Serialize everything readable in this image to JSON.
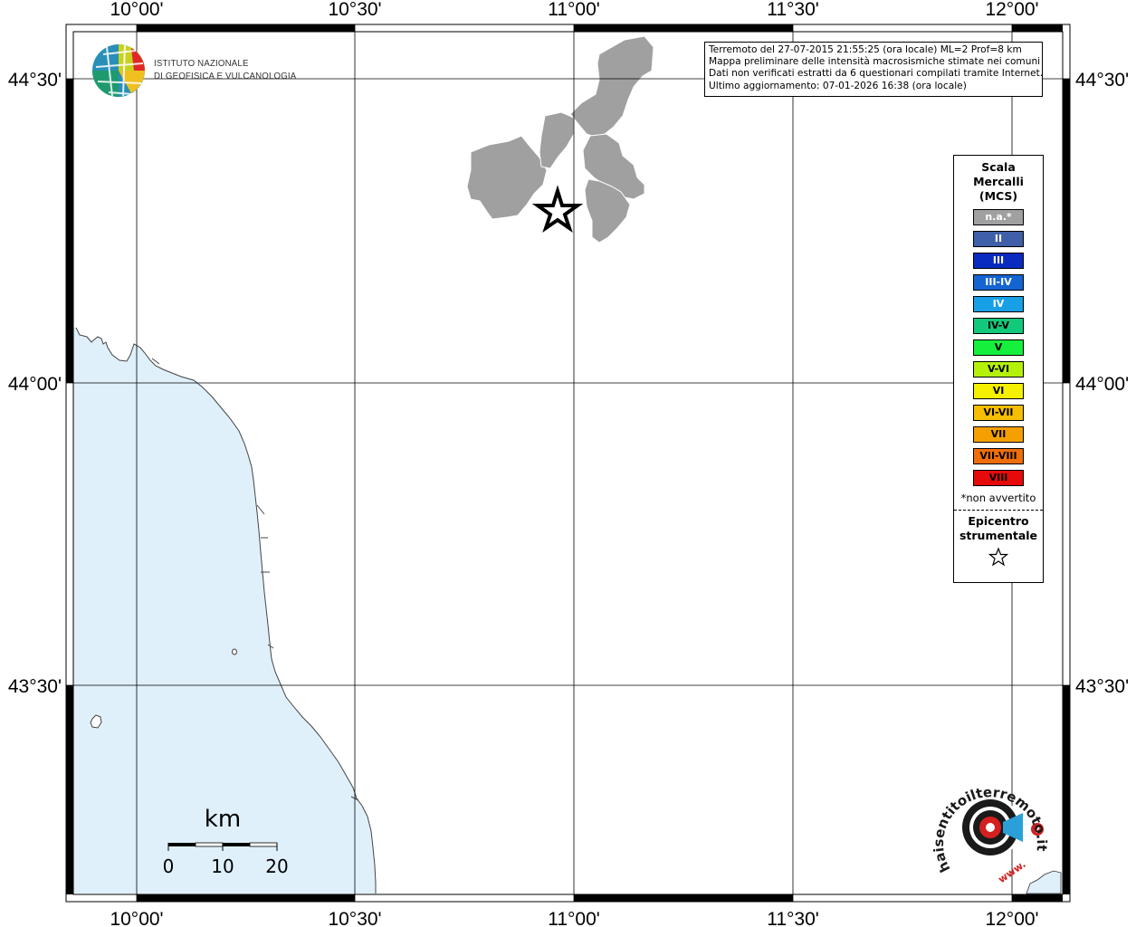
{
  "info": {
    "line1": "Terremoto del 27-07-2015 21:55:25 (ora locale) ML=2 Prof=8 km",
    "line2": "Mappa preliminare delle intensità macrosismiche stimate nei comuni",
    "line3": "Dati non verificati estratti da 6 questionari compilati tramite Internet.",
    "line4": "Ultimo aggiornamento: 07-01-2026 16:38 (ora locale)"
  },
  "logo_ingv": {
    "line1": "ISTITUTO NAZIONALE",
    "line2": "DI GEOFISICA E VULCANOLOGIA"
  },
  "logo_hsit": {
    "text": "haisentitoilterremoto.it",
    "prefix": "www."
  },
  "axes": {
    "longitude_labels": [
      "10°00'",
      "10°30'",
      "11°00'",
      "11°30'",
      "12°00'"
    ],
    "longitudes": [
      10.0,
      10.5,
      11.0,
      11.5,
      12.0
    ],
    "latitude_labels": [
      "44°30'",
      "44°00'",
      "43°30'"
    ],
    "latitudes": [
      44.5,
      44.0,
      43.5
    ]
  },
  "legend": {
    "title": "Scala Mercalli (MCS)",
    "title_lines": [
      "Scala",
      "Mercalli",
      "(MCS)"
    ],
    "items": [
      {
        "label": "n.a.*",
        "color": "#a0a0a0",
        "text_color": "#ffffff"
      },
      {
        "label": "II",
        "color": "#3f5fa8",
        "text_color": "#ffffff"
      },
      {
        "label": "III",
        "color": "#0a2bbf",
        "text_color": "#ffffff"
      },
      {
        "label": "III-IV",
        "color": "#1464d2",
        "text_color": "#ffffff"
      },
      {
        "label": "IV",
        "color": "#17a0e6",
        "text_color": "#ffffff"
      },
      {
        "label": "IV-V",
        "color": "#12c87a",
        "text_color": "#000000"
      },
      {
        "label": "V",
        "color": "#14f03c",
        "text_color": "#000000"
      },
      {
        "label": "V-VI",
        "color": "#b4f00a",
        "text_color": "#000000"
      },
      {
        "label": "VI",
        "color": "#f5f000",
        "text_color": "#000000"
      },
      {
        "label": "VI-VII",
        "color": "#f5be00",
        "text_color": "#000000"
      },
      {
        "label": "VII",
        "color": "#f5a000",
        "text_color": "#000000"
      },
      {
        "label": "VII-VIII",
        "color": "#f06e0a",
        "text_color": "#000000"
      },
      {
        "label": "VIII",
        "color": "#e60a0a",
        "text_color": "#000000"
      }
    ],
    "note": "*non avvertito",
    "epicenter_label": "Epicentro strumentale",
    "epicenter_lines": [
      "Epicentro",
      "strumentale"
    ]
  },
  "scalebar": {
    "unit": "km",
    "ticks": [
      "0",
      "10",
      "20"
    ]
  },
  "colors": {
    "sea": "#dff0fb",
    "municipality": "#a0a0a0",
    "frame": "#000000"
  }
}
